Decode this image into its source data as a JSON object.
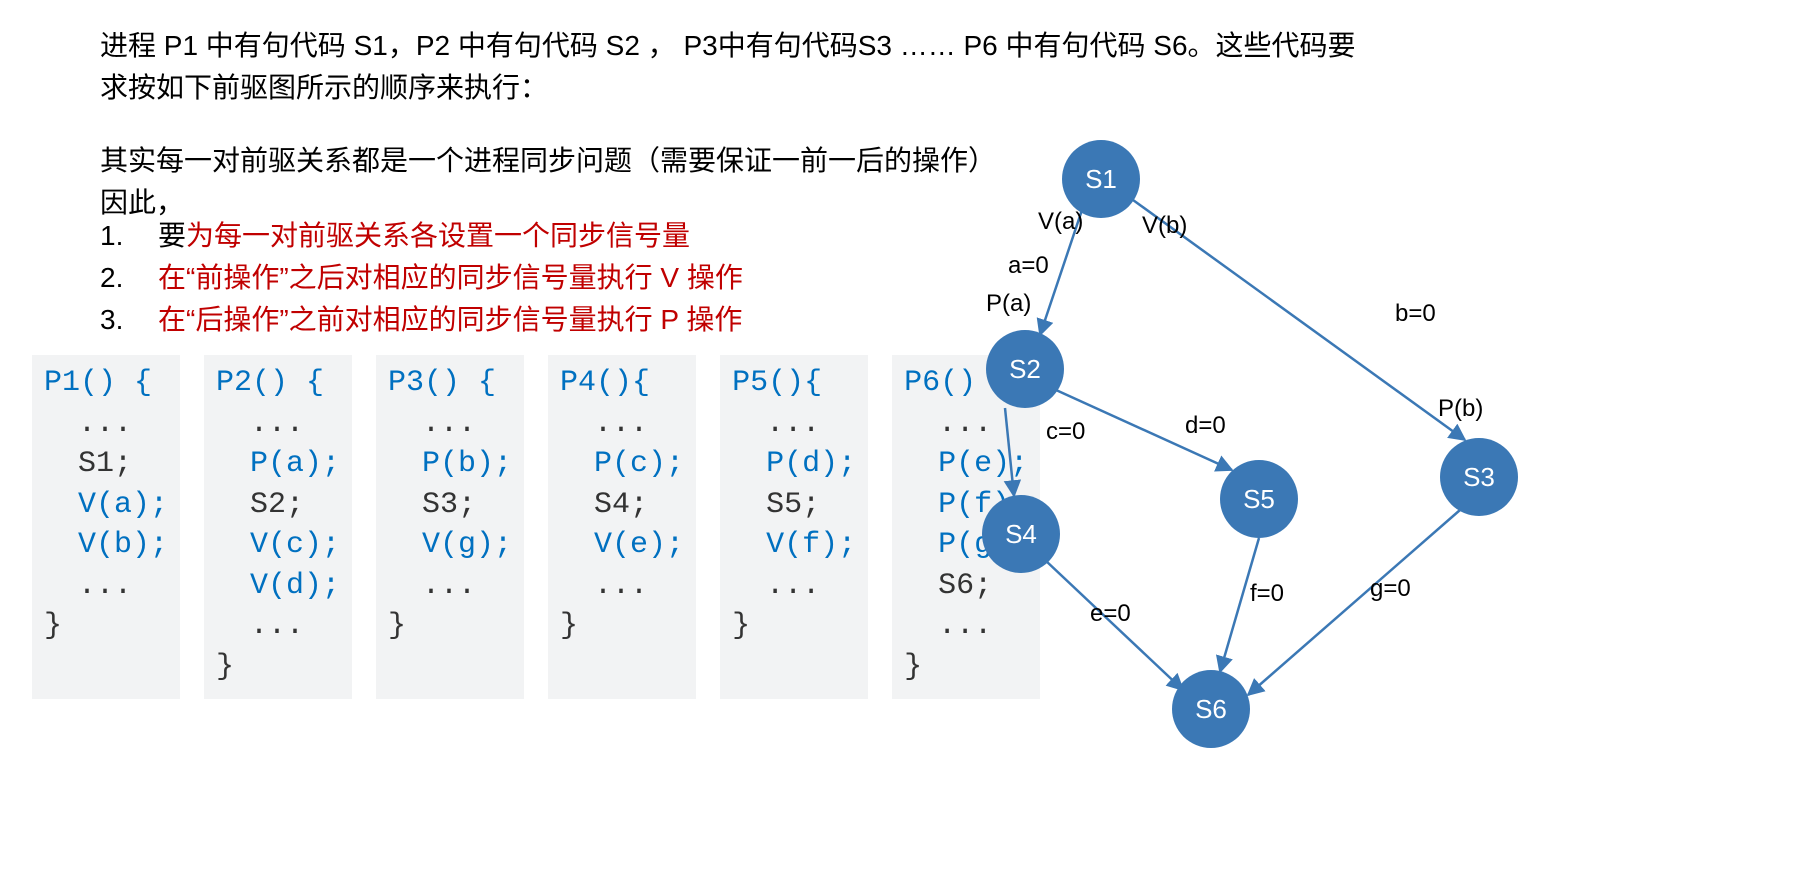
{
  "intro": "进程 P1 中有句代码 S1，P2 中有句代码 S2 ， P3中有句代码S3 …… P6 中有句代码 S6。这些代码要求按如下前驱图所示的顺序来执行：",
  "explain1": "其实每一对前驱关系都是一个进程同步问题（需要保证一前一后的操作）",
  "explain2": "因此，",
  "rules": {
    "n1": "1.",
    "r1a": "要",
    "r1b": "为每一对前驱关系各设置一个同步信号量",
    "n2": "2.",
    "r2": "在“前操作”之后对相应的同步信号量执行 V 操作",
    "n3": "3.",
    "r3": "在“后操作”之前对相应的同步信号量执行 P 操作"
  },
  "code": {
    "p1": {
      "hdr": "P1() {",
      "lines": [
        "...",
        "S1;",
        "V(a);",
        "V(b);",
        "..."
      ],
      "close": "}"
    },
    "p2": {
      "hdr": "P2() {",
      "lines": [
        "...",
        "P(a);",
        "S2;",
        "V(c);",
        "V(d);",
        "..."
      ],
      "close": "}"
    },
    "p3": {
      "hdr": "P3() {",
      "lines": [
        "...",
        "P(b);",
        "S3;",
        "V(g);",
        "..."
      ],
      "close": "}"
    },
    "p4": {
      "hdr": "P4(){",
      "lines": [
        "...",
        "P(c);",
        "S4;",
        "V(e);",
        "..."
      ],
      "close": "}"
    },
    "p5": {
      "hdr": "P5(){",
      "lines": [
        "...",
        "P(d);",
        "S5;",
        "V(f);",
        "..."
      ],
      "close": "}"
    },
    "p6": {
      "hdr": "P6() {",
      "lines": [
        "...",
        "P(e);",
        "P(f);",
        "P(g);",
        "S6;",
        "..."
      ],
      "close": "}"
    }
  },
  "nodes": {
    "s1": "S1",
    "s2": "S2",
    "s3": "S3",
    "s4": "S4",
    "s5": "S5",
    "s6": "S6"
  },
  "labels": {
    "va": "V(a)",
    "vb": "V(b)",
    "pa": "P(a)",
    "pb": "P(b)",
    "a0": "a=0",
    "b0": "b=0",
    "c0": "c=0",
    "d0": "d=0",
    "e0": "e=0",
    "f0": "f=0",
    "g0": "g=0"
  }
}
